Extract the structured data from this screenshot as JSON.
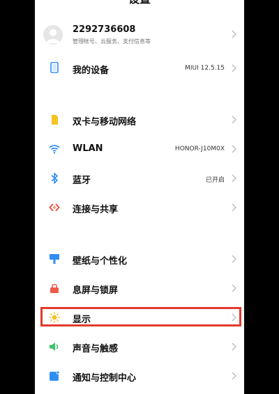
{
  "header": {
    "title": "设置"
  },
  "account": {
    "name": "2292736608",
    "subtitle": "管理帐号、云服务、支付信息等",
    "avatar_icon": "avatar-icon"
  },
  "device": {
    "label": "我的设备",
    "value": "MIUI 12.5.15",
    "icon": "phone-icon"
  },
  "network": [
    {
      "label": "双卡与移动网络",
      "value": "",
      "icon": "sim-card-icon",
      "color": "#f5c322"
    },
    {
      "label": "WLAN",
      "value": "HONOR-J10M0X",
      "icon": "wifi-icon",
      "color": "#2f8ef4"
    },
    {
      "label": "蓝牙",
      "value": "已开启",
      "icon": "bluetooth-icon",
      "color": "#2f8ef4"
    },
    {
      "label": "连接与共享",
      "value": "",
      "icon": "connection-share-icon",
      "color": "#ef4a3a"
    }
  ],
  "personal": [
    {
      "label": "壁纸与个性化",
      "value": "",
      "icon": "wallpaper-icon",
      "color": "#2f8ef4"
    },
    {
      "label": "息屏与锁屏",
      "value": "",
      "icon": "lock-icon",
      "color": "#ef5b4a"
    },
    {
      "label": "显示",
      "value": "",
      "icon": "sun-icon",
      "color": "#f6c02a"
    },
    {
      "label": "声音与触感",
      "value": "",
      "icon": "speaker-icon",
      "color": "#37c36b"
    },
    {
      "label": "通知与控制中心",
      "value": "",
      "icon": "notification-icon",
      "color": "#2f8ef4"
    }
  ],
  "highlight_color": "#e23a2c"
}
